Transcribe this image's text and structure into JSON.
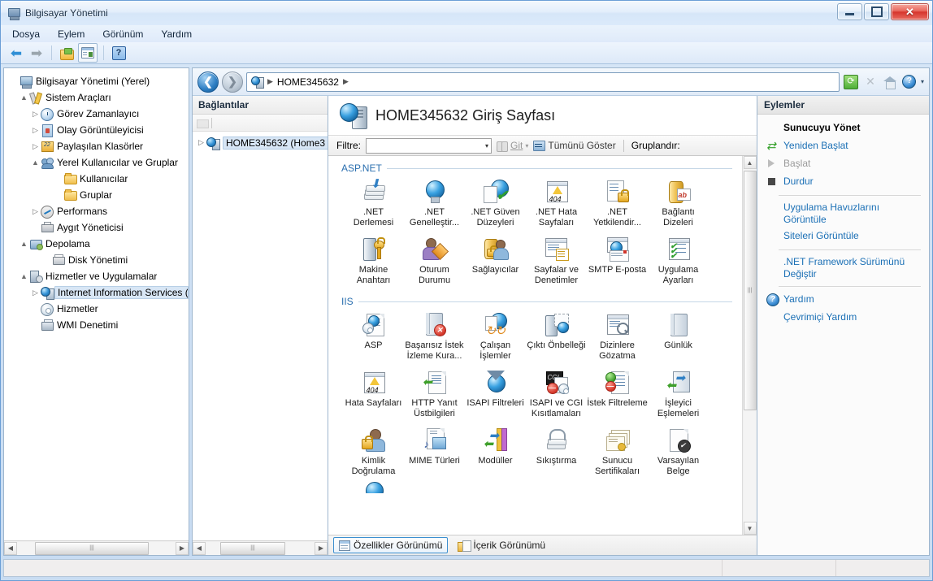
{
  "window": {
    "title": "Bilgisayar Yönetimi",
    "buttons": {
      "minimize": "–",
      "maximize": "□",
      "close": "✕"
    }
  },
  "menubar": {
    "items": [
      "Dosya",
      "Eylem",
      "Görünüm",
      "Yardım"
    ]
  },
  "toolbar": {
    "back": "back-arrow",
    "forward": "forward-arrow",
    "folder": "folder-icon",
    "properties": "properties-icon",
    "help": "?"
  },
  "tree": {
    "items": [
      {
        "label": "Bilgisayar Yönetimi (Yerel)",
        "indent": 0,
        "expander": "",
        "icon": "computer",
        "selected": false
      },
      {
        "label": "Sistem Araçları",
        "indent": 1,
        "expander": "▲",
        "icon": "tools",
        "selected": false
      },
      {
        "label": "Görev Zamanlayıcı",
        "indent": 2,
        "expander": "▷",
        "icon": "clock",
        "selected": false
      },
      {
        "label": "Olay Görüntüleyicisi",
        "indent": 2,
        "expander": "▷",
        "icon": "event",
        "selected": false
      },
      {
        "label": "Paylaşılan Klasörler",
        "indent": 2,
        "expander": "▷",
        "icon": "shared",
        "selected": false
      },
      {
        "label": "Yerel Kullanıcılar ve Gruplar",
        "indent": 2,
        "expander": "▲",
        "icon": "users",
        "selected": false
      },
      {
        "label": "Kullanıcılar",
        "indent": 3,
        "expander": "",
        "icon": "folder",
        "selected": false
      },
      {
        "label": "Gruplar",
        "indent": 3,
        "expander": "",
        "icon": "folder",
        "selected": false
      },
      {
        "label": "Performans",
        "indent": 2,
        "expander": "▷",
        "icon": "perf",
        "selected": false
      },
      {
        "label": "Aygıt Yöneticisi",
        "indent": 2,
        "expander": "",
        "icon": "device",
        "selected": false
      },
      {
        "label": "Depolama",
        "indent": 1,
        "expander": "▲",
        "icon": "storage",
        "selected": false
      },
      {
        "label": "Disk Yönetimi",
        "indent": 2,
        "expander": "",
        "icon": "disk",
        "selected": false
      },
      {
        "label": "Hizmetler ve Uygulamalar",
        "indent": 1,
        "expander": "▲",
        "icon": "services",
        "selected": false
      },
      {
        "label": "Internet Information Services (",
        "indent": 2,
        "expander": "▷",
        "icon": "iis",
        "selected": true
      },
      {
        "label": "Hizmetler",
        "indent": 2,
        "expander": "",
        "icon": "gear",
        "selected": false
      },
      {
        "label": "WMI Denetimi",
        "indent": 2,
        "expander": "",
        "icon": "wmi",
        "selected": false
      }
    ]
  },
  "address": {
    "back_icon": "back-circle-icon",
    "forward_icon": "forward-circle-icon",
    "crumb_icon": "server-icon",
    "crumb_text": "HOME345632",
    "sep": "▶",
    "refresh_icon": "refresh-icon",
    "stop_icon": "✕",
    "home_icon": "home-icon",
    "help_icon": "?",
    "help_caret": "▾"
  },
  "connections": {
    "header": "Bağlantılar",
    "node": {
      "expander": "▷",
      "label": "HOME345632 (Home3"
    }
  },
  "feature": {
    "title": "HOME345632 Giriş Sayfası",
    "filter_label": "Filtre:",
    "filter_value": "",
    "filter_caret": "▾",
    "go_label": "Git",
    "go_caret": "▾",
    "showall_label": "Tümünü Göster",
    "groupby_label": "Gruplandır:",
    "groups": [
      {
        "name": "ASP.NET",
        "rows": [
          [
            {
              "label": ".NET Derlemesi",
              "icon": "net-compilation-icon"
            },
            {
              "label": ".NET Genelleştir...",
              "icon": "net-globalization-icon"
            },
            {
              "label": ".NET Güven Düzeyleri",
              "icon": "net-trust-levels-icon"
            },
            {
              "label": ".NET Hata Sayfaları",
              "icon": "net-error-pages-icon"
            },
            {
              "label": ".NET Yetkilendir...",
              "icon": "net-authorization-icon"
            },
            {
              "label": "Bağlantı Dizeleri",
              "icon": "connection-strings-icon"
            }
          ],
          [
            {
              "label": "Makine Anahtarı",
              "icon": "machine-key-icon"
            },
            {
              "label": "Oturum Durumu",
              "icon": "session-state-icon"
            },
            {
              "label": "Sağlayıcılar",
              "icon": "providers-icon"
            },
            {
              "label": "Sayfalar ve Denetimler",
              "icon": "pages-and-controls-icon"
            },
            {
              "label": "SMTP E-posta",
              "icon": "smtp-email-icon"
            },
            {
              "label": "Uygulama Ayarları",
              "icon": "application-settings-icon"
            }
          ]
        ]
      },
      {
        "name": "IIS",
        "rows": [
          [
            {
              "label": "ASP",
              "icon": "asp-icon"
            },
            {
              "label": "Başarısız İstek İzleme Kura...",
              "icon": "failed-request-tracing-icon"
            },
            {
              "label": "Çalışan İşlemler",
              "icon": "worker-processes-icon"
            },
            {
              "label": "Çıktı Önbelleği",
              "icon": "output-caching-icon"
            },
            {
              "label": "Dizinlere Gözatma",
              "icon": "directory-browsing-icon"
            },
            {
              "label": "Günlük",
              "icon": "logging-icon"
            }
          ],
          [
            {
              "label": "Hata Sayfaları",
              "icon": "error-pages-icon"
            },
            {
              "label": "HTTP Yanıt Üstbilgileri",
              "icon": "http-response-headers-icon"
            },
            {
              "label": "ISAPI Filtreleri",
              "icon": "isapi-filters-icon"
            },
            {
              "label": "ISAPI ve CGI Kısıtlamaları",
              "icon": "isapi-cgi-restrictions-icon"
            },
            {
              "label": "İstek Filtreleme",
              "icon": "request-filtering-icon"
            },
            {
              "label": "İşleyici Eşlemeleri",
              "icon": "handler-mappings-icon"
            }
          ],
          [
            {
              "label": "Kimlik Doğrulama",
              "icon": "authentication-icon"
            },
            {
              "label": "MIME Türleri",
              "icon": "mime-types-icon"
            },
            {
              "label": "Modüller",
              "icon": "modules-icon"
            },
            {
              "label": "Sıkıştırma",
              "icon": "compression-icon"
            },
            {
              "label": "Sunucu Sertifikaları",
              "icon": "server-certificates-icon"
            },
            {
              "label": "Varsayılan Belge",
              "icon": "default-document-icon"
            }
          ]
        ]
      }
    ],
    "tabs": [
      {
        "label": "Özellikler Görünümü",
        "icon": "features-view-icon",
        "active": true
      },
      {
        "label": "İçerik Görünümü",
        "icon": "content-view-icon",
        "active": false
      }
    ]
  },
  "actions": {
    "header": "Eylemler",
    "items": [
      {
        "label": "Sunucuyu Yönet",
        "icon": "",
        "style": "bold"
      },
      {
        "label": "Yeniden Başlat",
        "icon": "restart-icon",
        "style": "link"
      },
      {
        "label": "Başlat",
        "icon": "play-icon",
        "style": "disabled"
      },
      {
        "label": "Durdur",
        "icon": "stop-icon",
        "style": "link"
      },
      {
        "separator": true
      },
      {
        "label": "Uygulama Havuzlarını Görüntüle",
        "icon": "",
        "style": "link"
      },
      {
        "label": "Siteleri Görüntüle",
        "icon": "",
        "style": "link"
      },
      {
        "separator": true
      },
      {
        "label": ".NET Framework Sürümünü Değiştir",
        "icon": "",
        "style": "link"
      },
      {
        "separator": true
      },
      {
        "label": "Yardım",
        "icon": "help-icon",
        "style": "link"
      },
      {
        "label": "Çevrimiçi Yardım",
        "icon": "",
        "style": "link"
      }
    ]
  },
  "scroll": {
    "up": "▲",
    "down": "▼",
    "left": "◀",
    "right": "▶",
    "grip": "|||"
  },
  "colors": {
    "link": "#1a6fb5",
    "group_header": "#2b6faf",
    "selection": "#d8e6f5",
    "accent": "#3c8fd0"
  }
}
